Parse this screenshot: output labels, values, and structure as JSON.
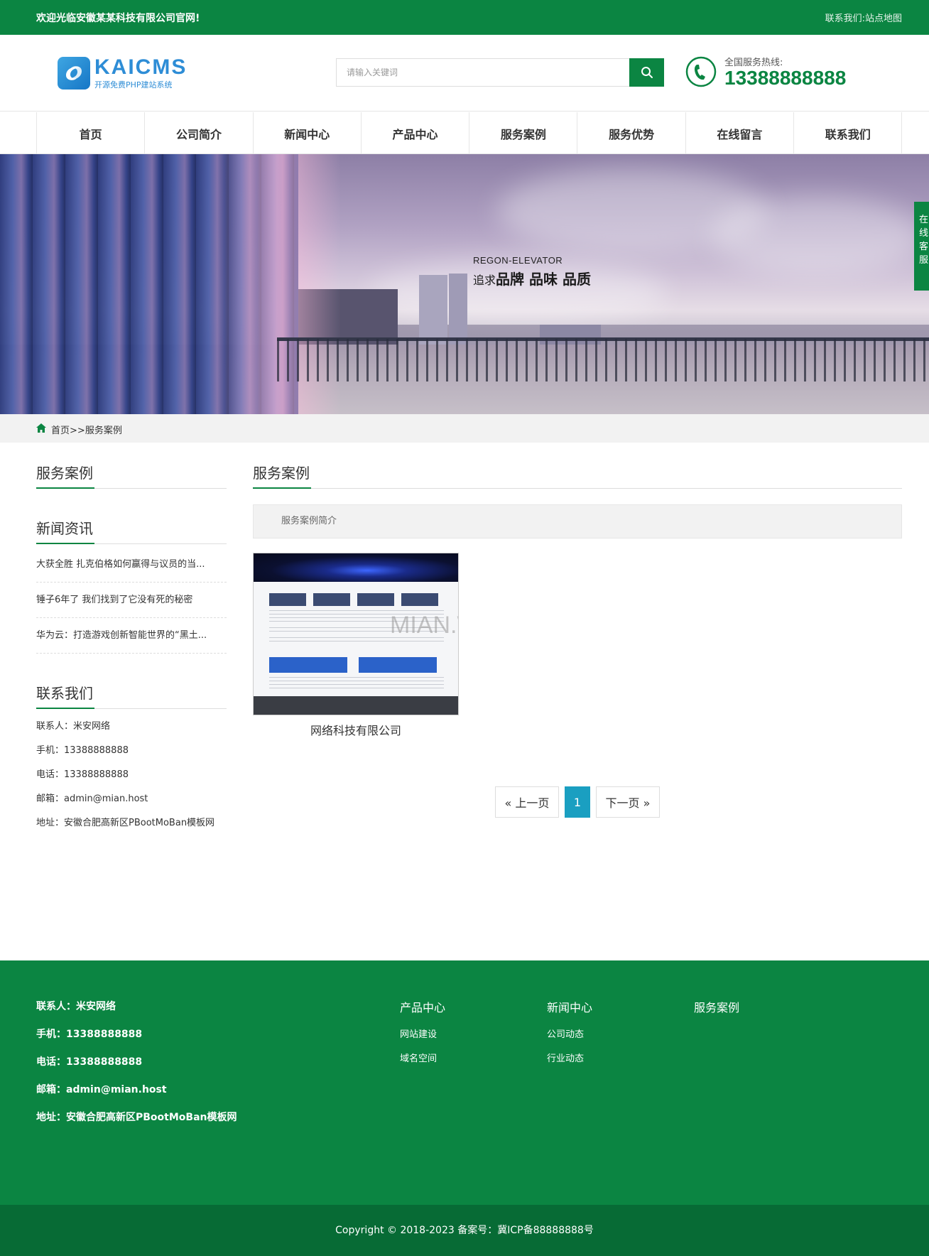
{
  "topbar": {
    "welcome": "欢迎光临安徽某某科技有限公司官网!",
    "contact_link": "联系我们",
    "separator": ":",
    "sitemap_link": "站点地图"
  },
  "header": {
    "logo_brand": "KAICMS",
    "logo_tagline": "开源免费PHP建站系统",
    "search_placeholder": "请输入关键词",
    "hotline_label": "全国服务热线:",
    "hotline_number": "13388888888"
  },
  "nav": {
    "items": [
      "首页",
      "公司简介",
      "新闻中心",
      "产品中心",
      "服务案例",
      "服务优势",
      "在线留言",
      "联系我们"
    ]
  },
  "banner": {
    "tag_en": "REGON-ELEVATOR",
    "tag_cn_prefix": "追求",
    "tag_cn_main": "品牌 品味 品质"
  },
  "float_service": "在线客服«",
  "breadcrumb": {
    "home": "首页",
    "sep": ">>",
    "current": "服务案例"
  },
  "sidebar": {
    "section_title": "服务案例",
    "news_title": "新闻资讯",
    "news": [
      "大获全胜 扎克伯格如何赢得与议员的当...",
      "锤子6年了 我们找到了它没有死的秘密",
      "华为云：打造游戏创新智能世界的“黑土..."
    ],
    "contact_title": "联系我们",
    "contact": [
      "联系人：米安网络",
      "手机：13388888888",
      "电话：13388888888",
      "邮箱：admin@mian.host",
      "地址：安徽合肥高新区PBootMoBan模板网"
    ]
  },
  "main": {
    "title": "服务案例",
    "intro": "服务案例简介",
    "cases": [
      {
        "caption": "网络科技有限公司",
        "watermark": "MIAN.WORK"
      }
    ]
  },
  "pager": {
    "prev": "« 上一页",
    "current": "1",
    "next": "下一页 »"
  },
  "footer": {
    "contact": [
      "联系人：米安网络",
      "手机：13388888888",
      "电话：13388888888",
      "邮箱：admin@mian.host",
      "地址：安徽合肥高新区PBootMoBan模板网"
    ],
    "columns": [
      {
        "title": "产品中心",
        "links": [
          "网站建设",
          "域名空间"
        ]
      },
      {
        "title": "新闻中心",
        "links": [
          "公司动态",
          "行业动态"
        ]
      },
      {
        "title": "服务案例",
        "links": []
      }
    ],
    "copyright": "Copyright © 2018-2023 备案号：冀ICP备88888888号"
  },
  "colors": {
    "brand_green": "#0b8542",
    "footer_dark_green": "#076b35",
    "pager_active": "#1a9fc1",
    "logo_blue": "#2e8dd6"
  },
  "icons": [
    "search-icon",
    "phone-icon",
    "home-icon",
    "logo-mark-icon"
  ]
}
